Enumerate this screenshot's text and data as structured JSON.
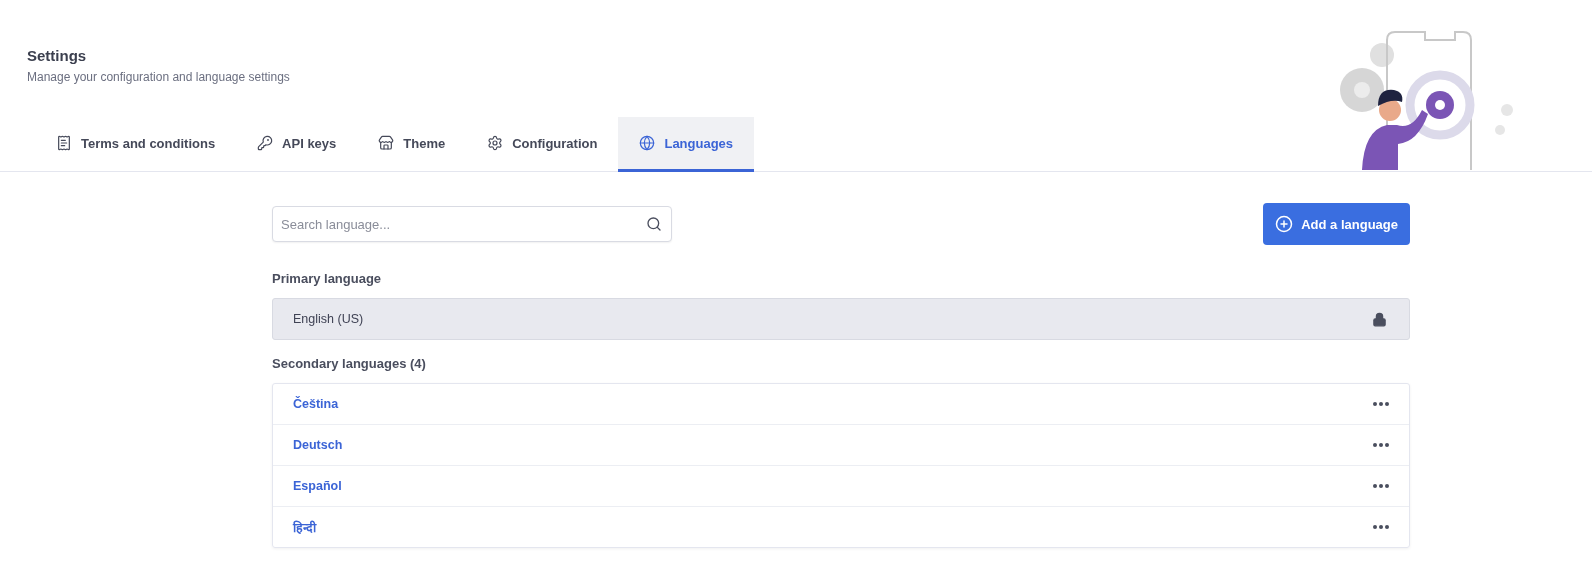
{
  "header": {
    "title": "Settings",
    "subtitle": "Manage your configuration and language settings"
  },
  "tabs": [
    {
      "label": "Terms and conditions",
      "selected": false
    },
    {
      "label": "API keys",
      "selected": false
    },
    {
      "label": "Theme",
      "selected": false
    },
    {
      "label": "Configuration",
      "selected": false
    },
    {
      "label": "Languages",
      "selected": true
    }
  ],
  "search": {
    "placeholder": "Search language..."
  },
  "add_button": {
    "label": "Add a language"
  },
  "primary": {
    "heading": "Primary language",
    "value": "English (US)",
    "locked": true
  },
  "secondary": {
    "heading": "Secondary languages (4)",
    "items": [
      {
        "name": "Čeština"
      },
      {
        "name": "Deutsch"
      },
      {
        "name": "Español"
      },
      {
        "name": "हिन्दी"
      }
    ]
  }
}
